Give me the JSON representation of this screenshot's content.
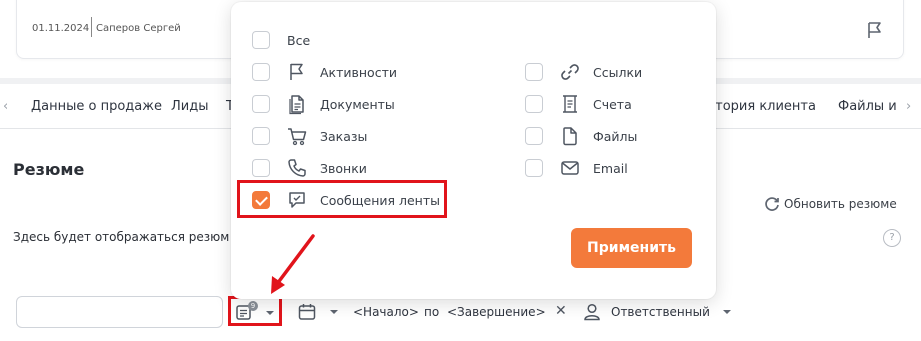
{
  "card": {
    "date": "01.11.2024",
    "author": "Саперов Сергей"
  },
  "tabs": {
    "prev_arrow": "‹",
    "next_arrow": "›",
    "items": [
      "Данные о продаже",
      "Лиды",
      "Т",
      "стория клиента",
      "Файлы и"
    ]
  },
  "resume": {
    "title": "Резюме",
    "refresh_label": "Обновить резюме",
    "placeholder_text": "Здесь будет отображаться резюм",
    "help": "?"
  },
  "toolbar": {
    "feed_filter_badge": "9",
    "start_label": "<Начало>",
    "to_label": "по",
    "end_label": "<Завершение>",
    "clear": "✕",
    "responsible_label": "Ответственный"
  },
  "filter_menu": {
    "all_label": "Все",
    "left_options": [
      {
        "label": "Активности",
        "icon": "flag-icon",
        "checked": false
      },
      {
        "label": "Документы",
        "icon": "document-icon",
        "checked": false
      },
      {
        "label": "Заказы",
        "icon": "cart-icon",
        "checked": false
      },
      {
        "label": "Звонки",
        "icon": "phone-icon",
        "checked": false
      },
      {
        "label": "Сообщения ленты",
        "icon": "chat-icon",
        "checked": true
      }
    ],
    "right_options": [
      {
        "label": "Ссылки",
        "icon": "link-icon",
        "checked": false
      },
      {
        "label": "Счета",
        "icon": "invoice-icon",
        "checked": false
      },
      {
        "label": "Файлы",
        "icon": "file-icon",
        "checked": false
      },
      {
        "label": "Email",
        "icon": "mail-icon",
        "checked": false
      }
    ],
    "apply_label": "Применить"
  },
  "colors": {
    "accent": "#f37a3b",
    "annotation_red": "#e1141b"
  }
}
